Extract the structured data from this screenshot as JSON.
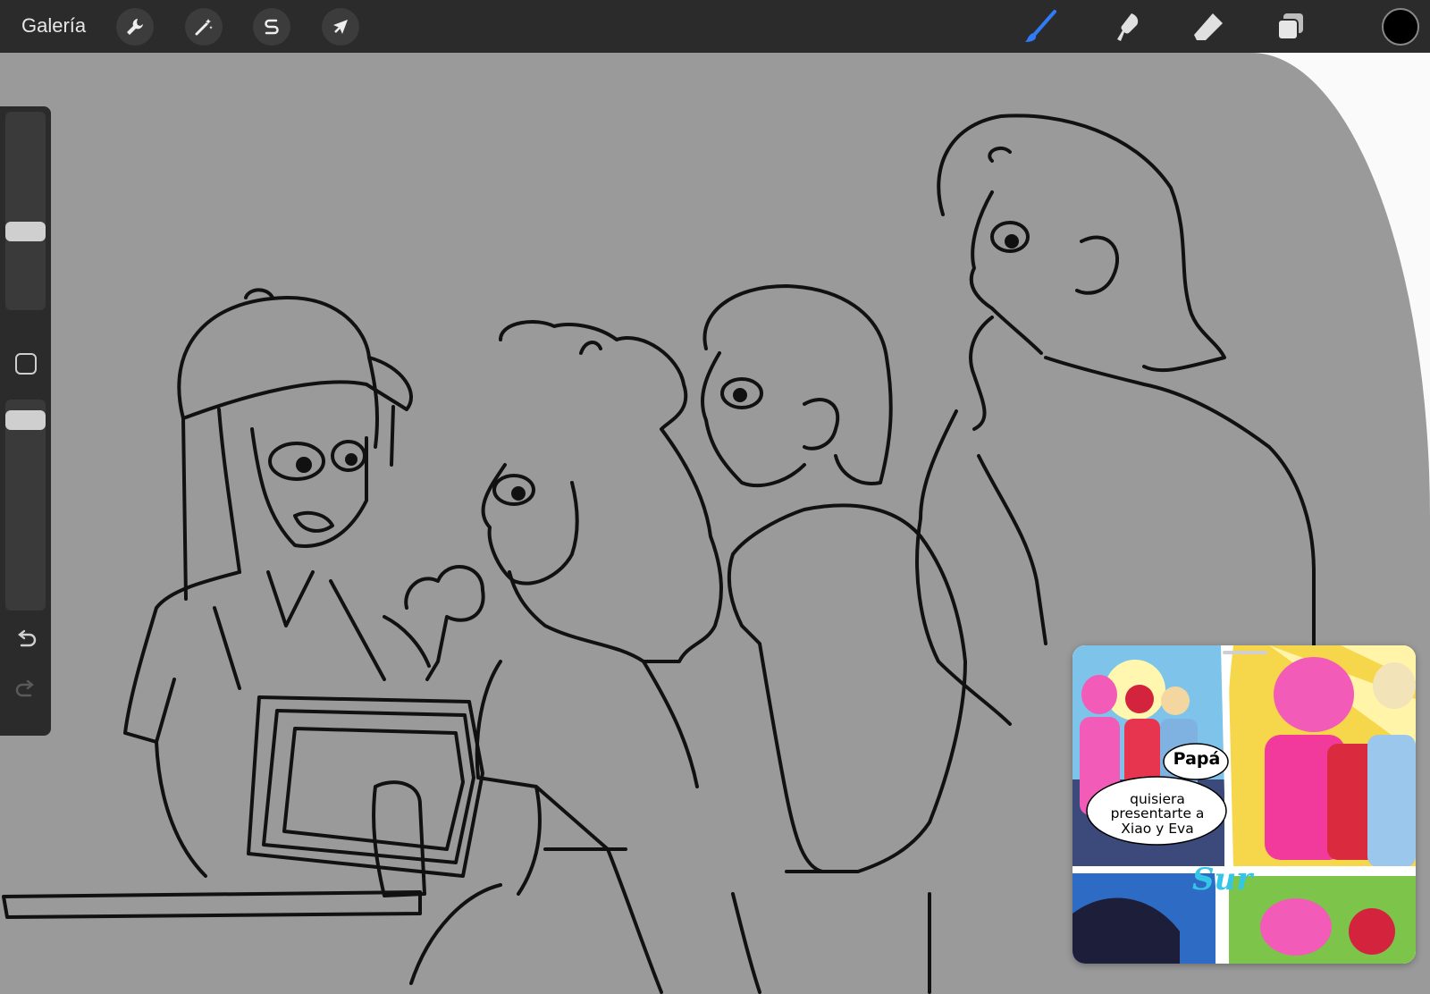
{
  "app": {
    "gallery_label": "Galería"
  },
  "toolbar": {
    "left_tools": [
      {
        "name": "actions",
        "icon": "wrench-icon"
      },
      {
        "name": "adjustments",
        "icon": "magic-wand-icon"
      },
      {
        "name": "selection",
        "icon": "selection-s-icon"
      },
      {
        "name": "transform",
        "icon": "arrow-cursor-icon"
      }
    ],
    "right_tools": [
      {
        "name": "brush",
        "icon": "brush-icon",
        "active": true
      },
      {
        "name": "smudge",
        "icon": "smudge-icon"
      },
      {
        "name": "eraser",
        "icon": "eraser-icon"
      },
      {
        "name": "layers",
        "icon": "layers-icon"
      }
    ],
    "current_color": "#000000",
    "accent_color": "#2f7cf6"
  },
  "sidebar": {
    "brush_size_level": 0.38,
    "opacity_level": 0.92,
    "icons": [
      "modify-square-icon",
      "undo-icon",
      "redo-icon"
    ]
  },
  "canvas": {
    "background_color": "#9a9a9a",
    "line_color": "#111111"
  },
  "reference": {
    "bubble_1": "Papá",
    "bubble_2": "quisiera presentarte a Xiao y Eva",
    "logo": "Sur"
  }
}
